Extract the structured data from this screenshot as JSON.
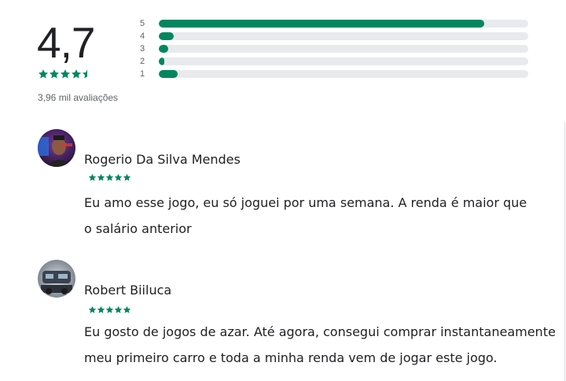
{
  "rating_summary": {
    "average": "4,7",
    "stars": 4.5,
    "review_count": "3,96 mil avaliações",
    "distribution": [
      {
        "stars": "5",
        "fraction": 0.88
      },
      {
        "stars": "4",
        "fraction": 0.04
      },
      {
        "stars": "3",
        "fraction": 0.025
      },
      {
        "stars": "2",
        "fraction": 0.015
      },
      {
        "stars": "1",
        "fraction": 0.05
      }
    ]
  },
  "colors": {
    "accent": "#01875f",
    "track": "#e8eaed",
    "text": "#202124",
    "muted": "#5f6368"
  },
  "reviews": [
    {
      "name": "Rogerio Da Silva Mendes",
      "stars": 5,
      "text_lines": [
        "Eu amo esse jogo, eu só joguei por uma semana. A renda é maior que",
        "o salário anterior"
      ]
    },
    {
      "name": "Robert Biiluca",
      "stars": 5,
      "text_lines": [
        "Eu gosto de jogos de azar. Até agora, consegui comprar instantaneamente",
        "meu primeiro carro e toda a minha renda vem de jogar este jogo."
      ]
    }
  ]
}
